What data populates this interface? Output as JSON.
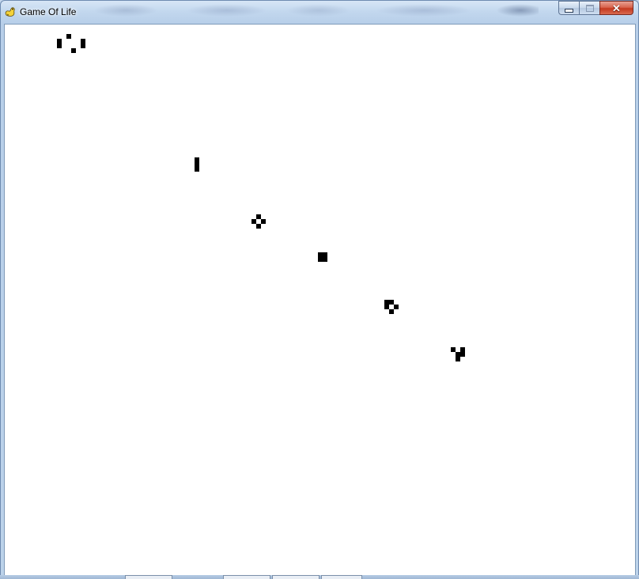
{
  "window": {
    "title": "Game Of Life",
    "app_icon": "pygame-snake-icon",
    "controls": [
      "minimize-icon",
      "maximize-icon",
      "close-icon"
    ]
  },
  "board": {
    "background": "#ffffff",
    "cell_color": "#000000",
    "live_cells": [
      [
        13,
        2
      ],
      [
        11,
        3
      ],
      [
        16,
        3
      ],
      [
        11,
        4
      ],
      [
        16,
        4
      ],
      [
        14,
        5
      ],
      [
        40,
        28
      ],
      [
        40,
        29
      ],
      [
        40,
        30
      ],
      [
        53,
        40
      ],
      [
        52,
        41
      ],
      [
        54,
        41
      ],
      [
        53,
        42
      ],
      [
        66,
        48
      ],
      [
        67,
        48
      ],
      [
        66,
        49
      ],
      [
        67,
        49
      ],
      [
        80,
        58
      ],
      [
        81,
        58
      ],
      [
        80,
        59
      ],
      [
        82,
        59
      ],
      [
        81,
        60
      ],
      [
        94,
        68
      ],
      [
        96,
        68
      ],
      [
        95,
        69
      ],
      [
        96,
        69
      ],
      [
        95,
        70
      ]
    ]
  }
}
